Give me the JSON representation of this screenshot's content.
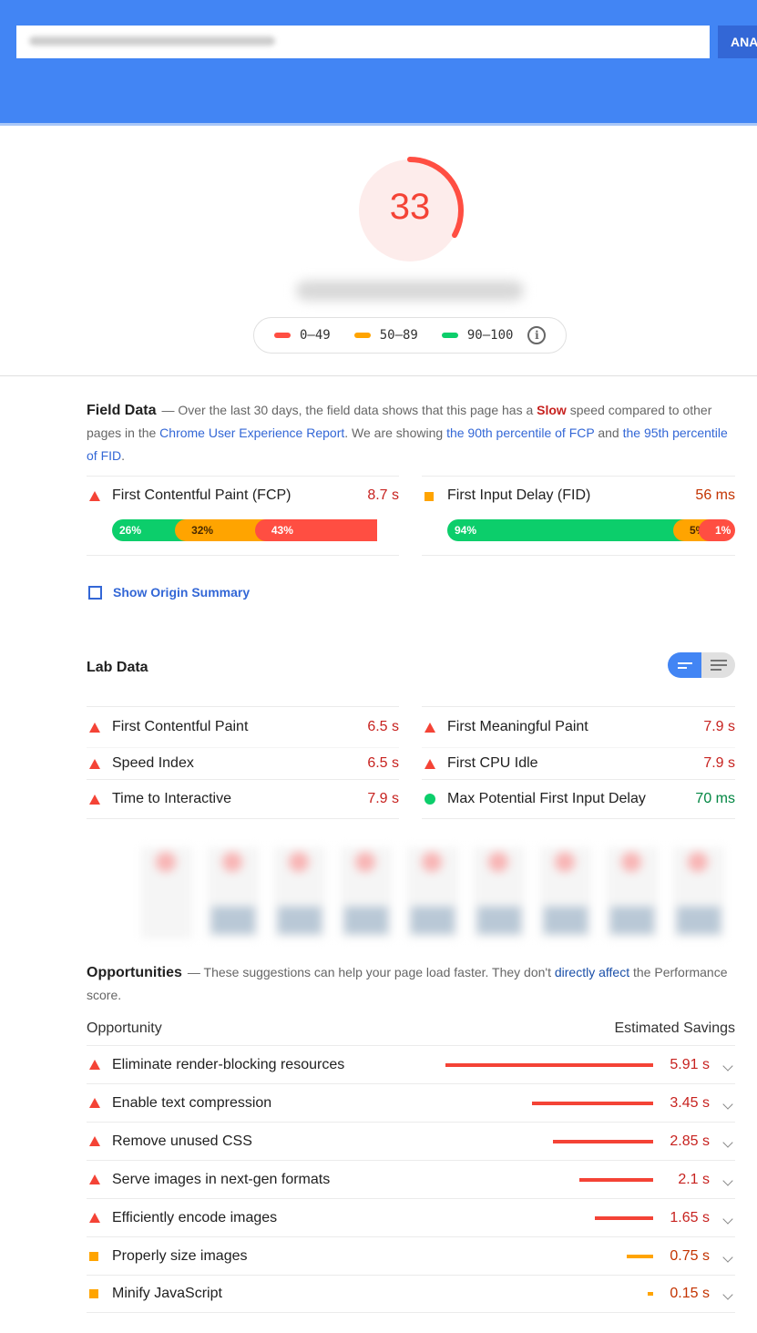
{
  "header": {
    "url_value": "https://www.example.com/",
    "analyze_label": "ANALYZE"
  },
  "score": {
    "value": "33",
    "fraction": 0.33,
    "color": "#ff4e42"
  },
  "legend": {
    "items": [
      {
        "range": "0–49",
        "color": "#ff4e42"
      },
      {
        "range": "50–89",
        "color": "#ffa400"
      },
      {
        "range": "90–100",
        "color": "#0cce6b"
      }
    ]
  },
  "field_data": {
    "title": "Field Data",
    "desc_1": "— Over the last 30 days, the field data shows that this page has a ",
    "speed": "Slow",
    "desc_2": " speed compared to other pages in the ",
    "link_crux": "Chrome User Experience Report",
    "desc_3": ". We are showing ",
    "link_fcp": "the 90th percentile of FCP",
    "desc_4": " and ",
    "link_fid": "the 95th percentile of FID",
    "desc_5": ".",
    "metrics": [
      {
        "label": "First Contentful Paint (FCP)",
        "value": "8.7 s",
        "status": "fail",
        "distribution": [
          {
            "pct": 26,
            "label": "26%"
          },
          {
            "pct": 32,
            "label": "32%"
          },
          {
            "pct": 43,
            "label": "43%"
          }
        ]
      },
      {
        "label": "First Input Delay (FID)",
        "value": "56 ms",
        "status": "average",
        "distribution": [
          {
            "pct": 94,
            "label": "94%"
          },
          {
            "pct": 5,
            "label": "5%"
          },
          {
            "pct": 1,
            "label": "1%"
          }
        ]
      }
    ],
    "origin_summary_label": "Show Origin Summary"
  },
  "lab_data": {
    "title": "Lab Data",
    "left": [
      {
        "label": "First Contentful Paint",
        "value": "6.5 s",
        "status": "fail"
      },
      {
        "label": "Speed Index",
        "value": "6.5 s",
        "status": "fail"
      },
      {
        "label": "Time to Interactive",
        "value": "7.9 s",
        "status": "fail"
      }
    ],
    "right": [
      {
        "label": "First Meaningful Paint",
        "value": "7.9 s",
        "status": "fail"
      },
      {
        "label": "First CPU Idle",
        "value": "7.9 s",
        "status": "fail"
      },
      {
        "label": "Max Potential First Input Delay",
        "value": "70 ms",
        "status": "pass"
      }
    ]
  },
  "opportunities": {
    "title": "Opportunities",
    "desc_1": "— These suggestions can help your page load faster. They don't ",
    "link": "directly affect",
    "desc_2": " the Performance score.",
    "col_opportunity": "Opportunity",
    "col_savings": "Estimated Savings",
    "items": [
      {
        "label": "Eliminate render-blocking resources",
        "value": "5.91 s",
        "seconds": 5.91,
        "status": "fail"
      },
      {
        "label": "Enable text compression",
        "value": "3.45 s",
        "seconds": 3.45,
        "status": "fail"
      },
      {
        "label": "Remove unused CSS",
        "value": "2.85 s",
        "seconds": 2.85,
        "status": "fail"
      },
      {
        "label": "Serve images in next-gen formats",
        "value": "2.1 s",
        "seconds": 2.1,
        "status": "fail"
      },
      {
        "label": "Efficiently encode images",
        "value": "1.65 s",
        "seconds": 1.65,
        "status": "fail"
      },
      {
        "label": "Properly size images",
        "value": "0.75 s",
        "seconds": 0.75,
        "status": "average"
      },
      {
        "label": "Minify JavaScript",
        "value": "0.15 s",
        "seconds": 0.15,
        "status": "average"
      }
    ]
  }
}
